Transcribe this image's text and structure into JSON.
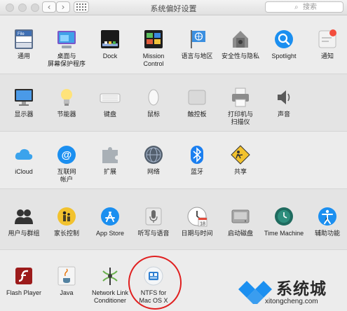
{
  "window": {
    "title": "系统偏好设置",
    "search_placeholder": "搜索"
  },
  "toolbar": {
    "back_label": "‹",
    "forward_label": "›"
  },
  "sections": [
    {
      "items": [
        {
          "label": "通用",
          "icon": "general-icon",
          "icon_text": "File"
        },
        {
          "label": "桌面与\n屏幕保护程序",
          "icon": "desktop-icon"
        },
        {
          "label": "Dock",
          "icon": "dock-icon"
        },
        {
          "label": "Mission\nControl",
          "icon": "mission-control-icon"
        },
        {
          "label": "语言与地区",
          "icon": "language-region-icon"
        },
        {
          "label": "安全性与隐私",
          "icon": "security-icon"
        },
        {
          "label": "Spotlight",
          "icon": "spotlight-icon"
        },
        {
          "label": "通知",
          "icon": "notifications-icon"
        }
      ]
    },
    {
      "items": [
        {
          "label": "显示器",
          "icon": "display-icon"
        },
        {
          "label": "节能器",
          "icon": "energy-saver-icon"
        },
        {
          "label": "键盘",
          "icon": "keyboard-icon"
        },
        {
          "label": "鼠标",
          "icon": "mouse-icon"
        },
        {
          "label": "触控板",
          "icon": "trackpad-icon"
        },
        {
          "label": "打印机与\n扫描仪",
          "icon": "printer-icon"
        },
        {
          "label": "声音",
          "icon": "sound-icon"
        }
      ]
    },
    {
      "items": [
        {
          "label": "iCloud",
          "icon": "icloud-icon"
        },
        {
          "label": "互联网\n帐户",
          "icon": "internet-accounts-icon",
          "icon_text": "@"
        },
        {
          "label": "扩展",
          "icon": "extensions-icon"
        },
        {
          "label": "网络",
          "icon": "network-icon"
        },
        {
          "label": "蓝牙",
          "icon": "bluetooth-icon"
        },
        {
          "label": "共享",
          "icon": "sharing-icon"
        }
      ]
    },
    {
      "items": [
        {
          "label": "用户与群组",
          "icon": "users-groups-icon"
        },
        {
          "label": "家长控制",
          "icon": "parental-controls-icon"
        },
        {
          "label": "App Store",
          "icon": "app-store-icon"
        },
        {
          "label": "听写与语音",
          "icon": "dictation-icon"
        },
        {
          "label": "日期与时间",
          "icon": "date-time-icon",
          "icon_text": "18"
        },
        {
          "label": "启动磁盘",
          "icon": "startup-disk-icon"
        },
        {
          "label": "Time Machine",
          "icon": "time-machine-icon"
        },
        {
          "label": "辅助功能",
          "icon": "accessibility-icon"
        }
      ]
    },
    {
      "items": [
        {
          "label": "Flash Player",
          "icon": "flash-player-icon"
        },
        {
          "label": "Java",
          "icon": "java-icon"
        },
        {
          "label": "Network Link\nConditioner",
          "icon": "network-link-conditioner-icon"
        },
        {
          "label": "NTFS for\nMac OS X",
          "icon": "ntfs-icon"
        }
      ]
    }
  ],
  "watermark": {
    "brand": "系统城",
    "url": "xitongcheng.com"
  },
  "colors": {
    "accent_blue": "#1b8ff0",
    "highlight_red": "#e02020",
    "notification_red": "#f34d3d"
  }
}
